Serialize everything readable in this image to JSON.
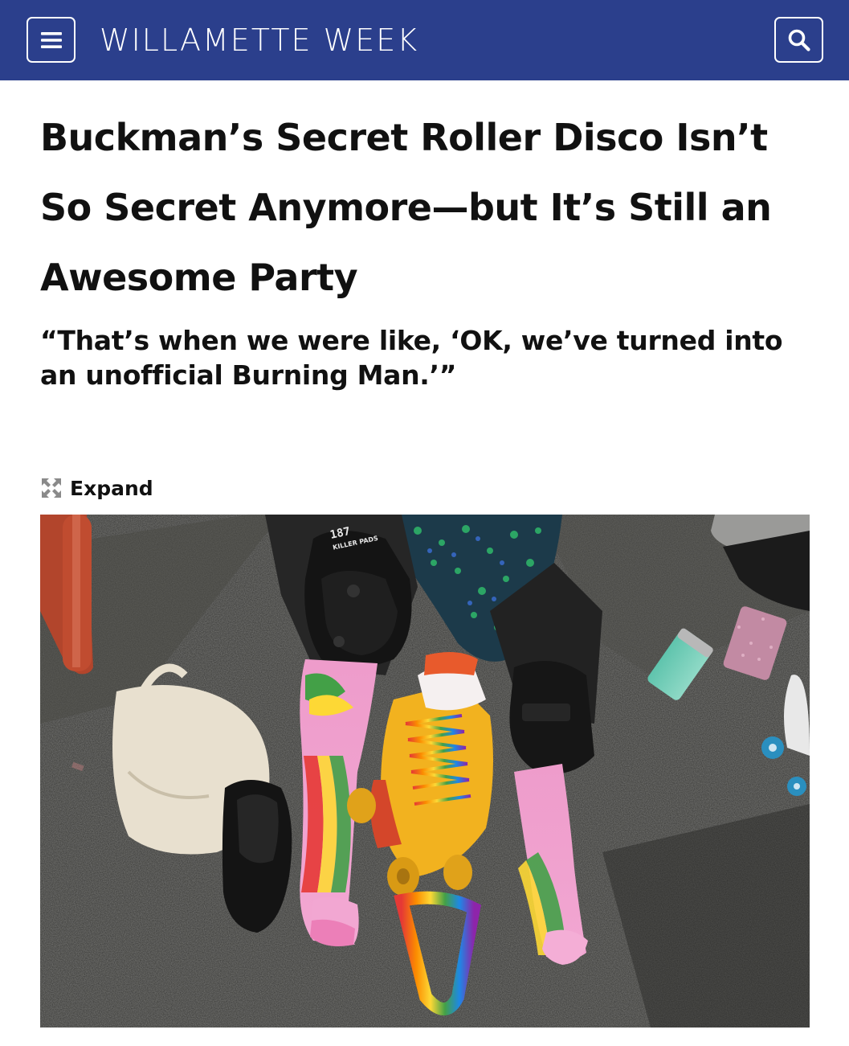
{
  "header": {
    "brand": "WILLAMETTE WEEK",
    "menu_icon": "hamburger-menu-icon",
    "search_icon": "search-icon",
    "background": "#2b3f8c"
  },
  "article": {
    "headline": "Buckman’s Secret Roller Disco Isn’t So Secret Anymore—but It’s Still an Awesome Party",
    "dek": "“That’s when we were like, ‘OK, we’ve turned into an unofficial Burning Man.’”",
    "expand_label": "Expand",
    "expand_icon": "expand-arrows-icon",
    "photo_brand_text": "187 KILLER PADS"
  }
}
